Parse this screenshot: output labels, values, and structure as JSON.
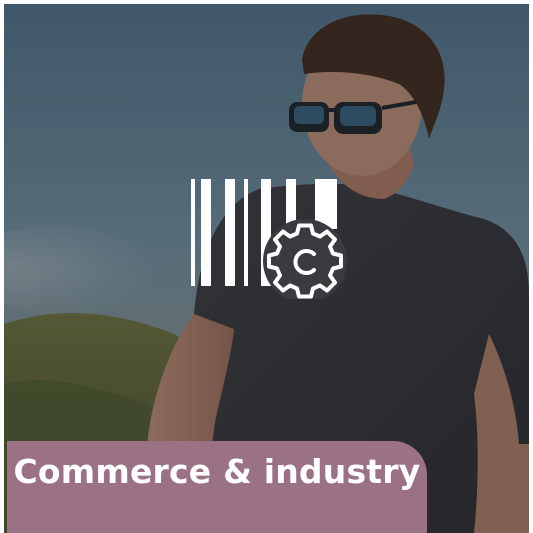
{
  "tile": {
    "label": "Commerce & industry",
    "icon": "barcode-gear-icon",
    "accent_color": "#9b7185",
    "image": "photo-man-sunglasses"
  }
}
